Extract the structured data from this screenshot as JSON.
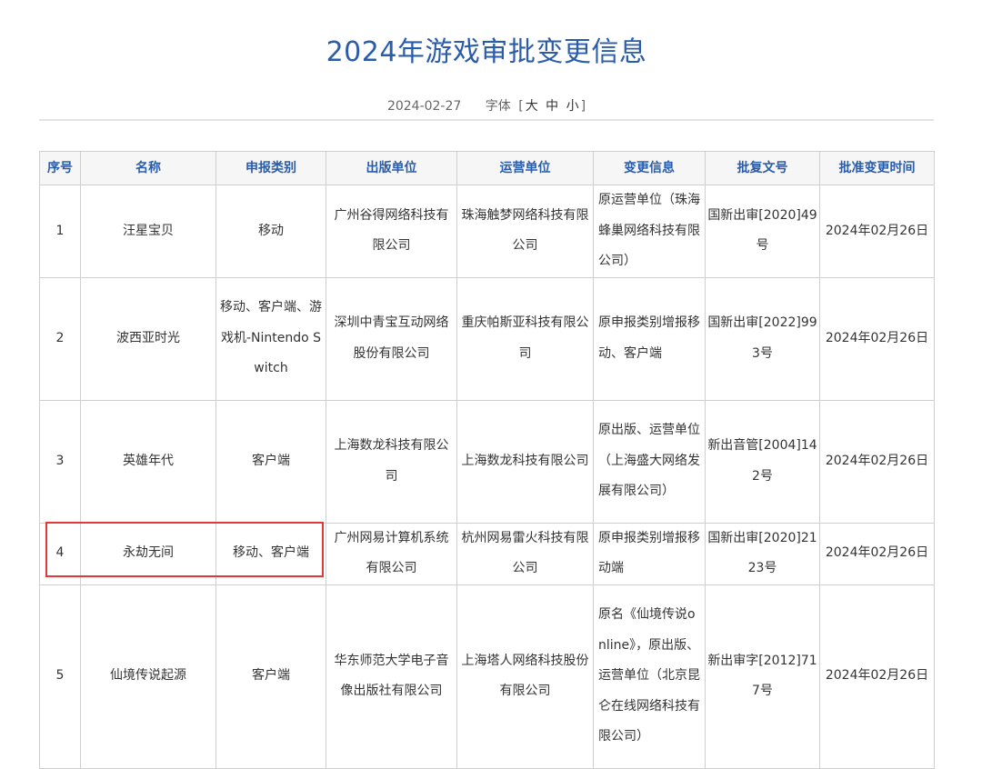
{
  "page": {
    "title": "2024年游戏审批变更信息",
    "date": "2024-02-27",
    "font_size_label": "字体",
    "font_size_options": [
      "大",
      "中",
      "小"
    ]
  },
  "table": {
    "headers": [
      "序号",
      "名称",
      "申报类别",
      "出版单位",
      "运营单位",
      "变更信息",
      "批复文号",
      "批准变更时间"
    ],
    "rows": [
      {
        "no": "1",
        "name": "汪星宝贝",
        "category": "移动",
        "publisher": "广州谷得网络科技有限公司",
        "operator": "珠海触梦网络科技有限公司",
        "change": "原运营单位（珠海蜂巢网络科技有限公司）",
        "approval": "国新出审[2020]49号",
        "date": "2024年02月26日"
      },
      {
        "no": "2",
        "name": "波西亚时光",
        "category": "移动、客户端、游戏机-Nintendo Switch",
        "publisher": "深圳中青宝互动网络股份有限公司",
        "operator": "重庆帕斯亚科技有限公司",
        "change": "原申报类别增报移动、客户端",
        "approval": "国新出审[2022]993号",
        "date": "2024年02月26日"
      },
      {
        "no": "3",
        "name": "英雄年代",
        "category": "客户端",
        "publisher": "上海数龙科技有限公司",
        "operator": "上海数龙科技有限公司",
        "change": "原出版、运营单位（上海盛大网络发展有限公司）",
        "approval": "新出音管[2004]142号",
        "date": "2024年02月26日"
      },
      {
        "no": "4",
        "name": "永劫无间",
        "category": "移动、客户端",
        "publisher": "广州网易计算机系统有限公司",
        "operator": "杭州网易雷火科技有限公司",
        "change": "原申报类别增报移动端",
        "approval": "国新出审[2020]2123号",
        "date": "2024年02月26日"
      },
      {
        "no": "5",
        "name": "仙境传说起源",
        "category": "客户端",
        "publisher": "华东师范大学电子音像出版社有限公司",
        "operator": "上海塔人网络科技股份有限公司",
        "change": "原名《仙境传说online》，原出版、运营单位（北京昆仑在线网络科技有限公司）",
        "approval": "新出审字[2012]717号",
        "date": "2024年02月26日"
      }
    ]
  },
  "highlight_color": "#e0393a",
  "accent_color": "#2a5caa"
}
